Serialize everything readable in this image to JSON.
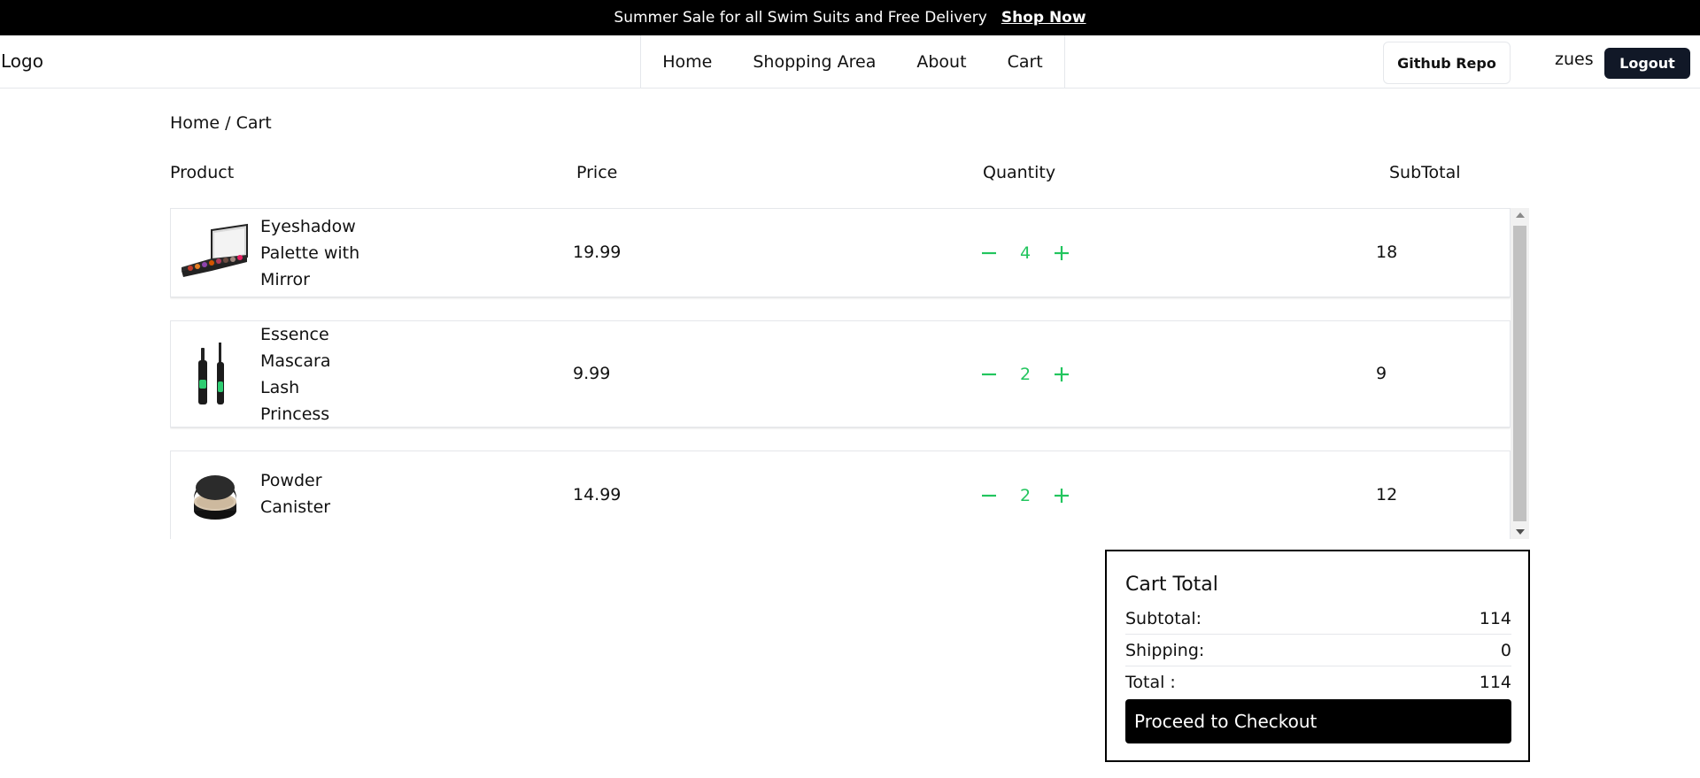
{
  "announcement": {
    "message": "Summer Sale for all Swim Suits and Free Delivery",
    "link": "Shop Now"
  },
  "header": {
    "logo": "Logo",
    "nav": [
      "Home",
      "Shopping Area",
      "About",
      "Cart"
    ],
    "github_label": "Github Repo",
    "username": "zues",
    "logout_label": "Logout"
  },
  "breadcrumb": "Home / Cart",
  "table": {
    "headers": [
      "Product",
      "Price",
      "Quantity",
      "SubTotal"
    ],
    "rows": [
      {
        "name": "Eyeshadow Palette with Mirror",
        "price": "19.99",
        "quantity": "4",
        "subtotal": "18",
        "icon": "eyeshadow-palette"
      },
      {
        "name": "Essence Mascara Lash Princess",
        "price": "9.99",
        "quantity": "2",
        "subtotal": "9",
        "icon": "mascara"
      },
      {
        "name": "Powder Canister",
        "price": "14.99",
        "quantity": "2",
        "subtotal": "12",
        "icon": "powder-canister"
      }
    ]
  },
  "cart_total": {
    "title": "Cart Total",
    "subtotal_label": "Subtotal:",
    "subtotal": "114",
    "shipping_label": "Shipping:",
    "shipping": "0",
    "total_label": "Total :",
    "total": "114",
    "checkout_label": "Proceed to Checkout"
  },
  "colors": {
    "accent_green": "#22c55e",
    "dark_button": "#111827",
    "announcement_bg": "#000000"
  }
}
